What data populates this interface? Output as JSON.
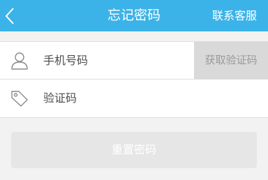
{
  "header": {
    "title": "忘记密码",
    "service_label": "联系客服"
  },
  "form": {
    "phone": {
      "placeholder": "手机号码",
      "icon": "user-icon"
    },
    "get_code_label": "获取验证码",
    "code": {
      "placeholder": "验证码",
      "icon": "tag-icon"
    }
  },
  "reset_label": "重置密码",
  "colors": {
    "header_bg": "#3cb3e8",
    "page_bg": "#f2f2f2",
    "disabled_button": "#e6e6e6",
    "get_code_bg": "#d9d9d9"
  }
}
